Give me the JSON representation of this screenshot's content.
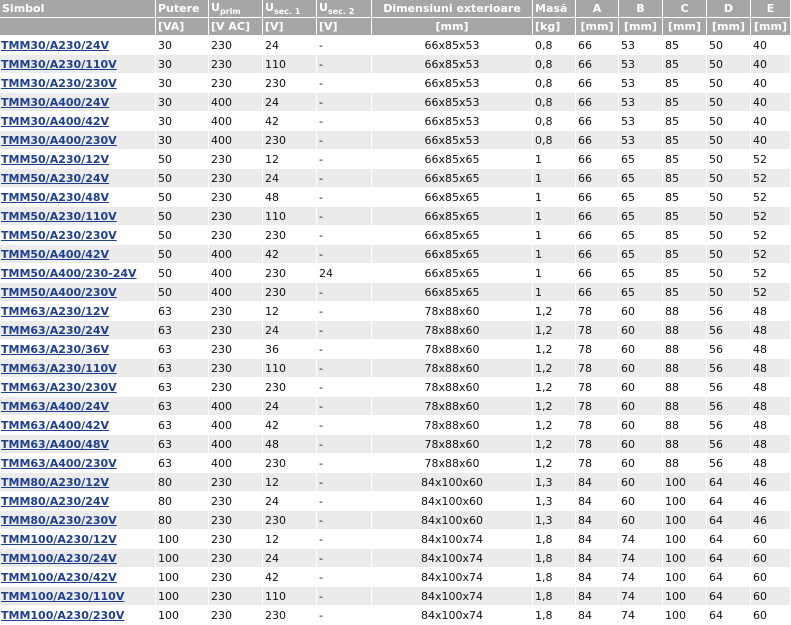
{
  "table": {
    "headers": {
      "simbol": "Simbol",
      "putere": "Putere",
      "uprim_main": "U",
      "uprim_sub": "prim",
      "usec1_main": "U",
      "usec1_sub": "sec. 1",
      "usec2_main": "U",
      "usec2_sub": "sec. 2",
      "dimensiuni": "Dimensiuni exterioare",
      "masa": "Masă",
      "a": "A",
      "b": "B",
      "c": "C",
      "d": "D",
      "e": "E"
    },
    "units": {
      "putere": "[VA]",
      "uprim": "[V AC]",
      "usec1": "[V]",
      "usec2": "[V]",
      "dimensiuni": "[mm]",
      "masa": "[kg]",
      "a": "[mm]",
      "b": "[mm]",
      "c": "[mm]",
      "d": "[mm]",
      "e": "[mm]"
    },
    "rows": [
      [
        "TMM30/A230/24V",
        "30",
        "230",
        "24",
        "-",
        "66x85x53",
        "0,8",
        "66",
        "53",
        "85",
        "50",
        "40"
      ],
      [
        "TMM30/A230/110V",
        "30",
        "230",
        "110",
        "-",
        "66x85x53",
        "0,8",
        "66",
        "53",
        "85",
        "50",
        "40"
      ],
      [
        "TMM30/A230/230V",
        "30",
        "230",
        "230",
        "-",
        "66x85x53",
        "0,8",
        "66",
        "53",
        "85",
        "50",
        "40"
      ],
      [
        "TMM30/A400/24V",
        "30",
        "400",
        "24",
        "-",
        "66x85x53",
        "0,8",
        "66",
        "53",
        "85",
        "50",
        "40"
      ],
      [
        "TMM30/A400/42V",
        "30",
        "400",
        "42",
        "-",
        "66x85x53",
        "0,8",
        "66",
        "53",
        "85",
        "50",
        "40"
      ],
      [
        "TMM30/A400/230V",
        "30",
        "400",
        "230",
        "-",
        "66x85x53",
        "0,8",
        "66",
        "53",
        "85",
        "50",
        "40"
      ],
      [
        "TMM50/A230/12V",
        "50",
        "230",
        "12",
        "-",
        "66x85x65",
        "1",
        "66",
        "65",
        "85",
        "50",
        "52"
      ],
      [
        "TMM50/A230/24V",
        "50",
        "230",
        "24",
        "-",
        "66x85x65",
        "1",
        "66",
        "65",
        "85",
        "50",
        "52"
      ],
      [
        "TMM50/A230/48V",
        "50",
        "230",
        "48",
        "-",
        "66x85x65",
        "1",
        "66",
        "65",
        "85",
        "50",
        "52"
      ],
      [
        "TMM50/A230/110V",
        "50",
        "230",
        "110",
        "-",
        "66x85x65",
        "1",
        "66",
        "65",
        "85",
        "50",
        "52"
      ],
      [
        "TMM50/A230/230V",
        "50",
        "230",
        "230",
        "-",
        "66x85x65",
        "1",
        "66",
        "65",
        "85",
        "50",
        "52"
      ],
      [
        "TMM50/A400/42V",
        "50",
        "400",
        "42",
        "-",
        "66x85x65",
        "1",
        "66",
        "65",
        "85",
        "50",
        "52"
      ],
      [
        "TMM50/A400/230-24V",
        "50",
        "400",
        "230",
        "24",
        "66x85x65",
        "1",
        "66",
        "65",
        "85",
        "50",
        "52"
      ],
      [
        "TMM50/A400/230V",
        "50",
        "400",
        "230",
        "-",
        "66x85x65",
        "1",
        "66",
        "65",
        "85",
        "50",
        "52"
      ],
      [
        "TMM63/A230/12V",
        "63",
        "230",
        "12",
        "-",
        "78x88x60",
        "1,2",
        "78",
        "60",
        "88",
        "56",
        "48"
      ],
      [
        "TMM63/A230/24V",
        "63",
        "230",
        "24",
        "-",
        "78x88x60",
        "1,2",
        "78",
        "60",
        "88",
        "56",
        "48"
      ],
      [
        "TMM63/A230/36V",
        "63",
        "230",
        "36",
        "-",
        "78x88x60",
        "1,2",
        "78",
        "60",
        "88",
        "56",
        "48"
      ],
      [
        "TMM63/A230/110V",
        "63",
        "230",
        "110",
        "-",
        "78x88x60",
        "1,2",
        "78",
        "60",
        "88",
        "56",
        "48"
      ],
      [
        "TMM63/A230/230V",
        "63",
        "230",
        "230",
        "-",
        "78x88x60",
        "1,2",
        "78",
        "60",
        "88",
        "56",
        "48"
      ],
      [
        "TMM63/A400/24V",
        "63",
        "400",
        "24",
        "-",
        "78x88x60",
        "1,2",
        "78",
        "60",
        "88",
        "56",
        "48"
      ],
      [
        "TMM63/A400/42V",
        "63",
        "400",
        "42",
        "-",
        "78x88x60",
        "1,2",
        "78",
        "60",
        "88",
        "56",
        "48"
      ],
      [
        "TMM63/A400/48V",
        "63",
        "400",
        "48",
        "-",
        "78x88x60",
        "1,2",
        "78",
        "60",
        "88",
        "56",
        "48"
      ],
      [
        "TMM63/A400/230V",
        "63",
        "400",
        "230",
        "-",
        "78x88x60",
        "1,2",
        "78",
        "60",
        "88",
        "56",
        "48"
      ],
      [
        "TMM80/A230/12V",
        "80",
        "230",
        "12",
        "-",
        "84x100x60",
        "1,3",
        "84",
        "60",
        "100",
        "64",
        "46"
      ],
      [
        "TMM80/A230/24V",
        "80",
        "230",
        "24",
        "-",
        "84x100x60",
        "1,3",
        "84",
        "60",
        "100",
        "64",
        "46"
      ],
      [
        "TMM80/A230/230V",
        "80",
        "230",
        "230",
        "-",
        "84x100x60",
        "1,3",
        "84",
        "60",
        "100",
        "64",
        "46"
      ],
      [
        "TMM100/A230/12V",
        "100",
        "230",
        "12",
        "-",
        "84x100x74",
        "1,8",
        "84",
        "74",
        "100",
        "64",
        "60"
      ],
      [
        "TMM100/A230/24V",
        "100",
        "230",
        "24",
        "-",
        "84x100x74",
        "1,8",
        "84",
        "74",
        "100",
        "64",
        "60"
      ],
      [
        "TMM100/A230/42V",
        "100",
        "230",
        "42",
        "-",
        "84x100x74",
        "1,8",
        "84",
        "74",
        "100",
        "64",
        "60"
      ],
      [
        "TMM100/A230/110V",
        "100",
        "230",
        "110",
        "-",
        "84x100x74",
        "1,8",
        "84",
        "74",
        "100",
        "64",
        "60"
      ],
      [
        "TMM100/A230/230V",
        "100",
        "230",
        "230",
        "-",
        "84x100x74",
        "1,8",
        "84",
        "74",
        "100",
        "64",
        "60"
      ]
    ]
  }
}
